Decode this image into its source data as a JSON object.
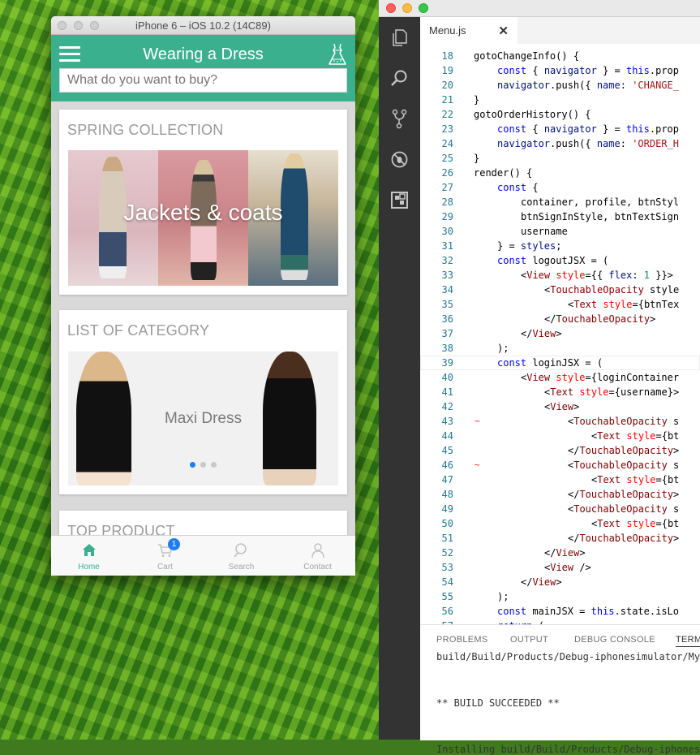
{
  "simulator": {
    "window_title": "iPhone 6 – iOS 10.2 (14C89)",
    "app": {
      "title": "Wearing a Dress",
      "search_placeholder": "What do you want to buy?",
      "sections": [
        {
          "title": "SPRING COLLECTION",
          "banner_caption": "Jackets & coats"
        },
        {
          "title": "LIST OF CATEGORY",
          "banner_caption": "Maxi Dress",
          "slide_count": 3,
          "active_slide": 1
        },
        {
          "title": "TOP PRODUCT"
        }
      ],
      "tabs": [
        {
          "label": "Home",
          "icon": "home-icon",
          "active": true
        },
        {
          "label": "Cart",
          "icon": "cart-icon",
          "badge": "1"
        },
        {
          "label": "Search",
          "icon": "search-icon"
        },
        {
          "label": "Contact",
          "icon": "person-icon"
        }
      ],
      "colors": {
        "brand": "#3ab08e",
        "active_tab": "#3ab08e",
        "badge": "#1e7ef0"
      }
    }
  },
  "editor": {
    "tab_label": "Menu.js",
    "close_glyph": "✕",
    "activity_icons": [
      "files-icon",
      "search-icon",
      "source-control-icon",
      "debug-icon",
      "extensions-icon"
    ],
    "lines": [
      {
        "n": "18",
        "indent": 1,
        "text": "gotoChangeInfo() {"
      },
      {
        "n": "19",
        "indent": 2,
        "text": "const { navigator } = this.prop"
      },
      {
        "n": "20",
        "indent": 2,
        "text": "navigator.push({ name: 'CHANGE_"
      },
      {
        "n": "21",
        "indent": 1,
        "text": "}"
      },
      {
        "n": "22",
        "indent": 1,
        "text": "gotoOrderHistory() {"
      },
      {
        "n": "23",
        "indent": 2,
        "text": "const { navigator } = this.prop"
      },
      {
        "n": "24",
        "indent": 2,
        "text": "navigator.push({ name: 'ORDER_H"
      },
      {
        "n": "25",
        "indent": 1,
        "text": "}"
      },
      {
        "n": "26",
        "indent": 1,
        "text": "render() {"
      },
      {
        "n": "27",
        "indent": 2,
        "text": "const {"
      },
      {
        "n": "28",
        "indent": 3,
        "text": "container, profile, btnStyl"
      },
      {
        "n": "29",
        "indent": 3,
        "text": "btnSignInStyle, btnTextSign"
      },
      {
        "n": "30",
        "indent": 3,
        "text": "username"
      },
      {
        "n": "31",
        "indent": 2,
        "text": "} = styles;"
      },
      {
        "n": "32",
        "indent": 2,
        "text": "const logoutJSX = ("
      },
      {
        "n": "33",
        "indent": 3,
        "text": "<View style={{ flex: 1 }}>"
      },
      {
        "n": "34",
        "indent": 4,
        "text": "<TouchableOpacity style"
      },
      {
        "n": "35",
        "indent": 5,
        "text": "<Text style={btnTex"
      },
      {
        "n": "36",
        "indent": 4,
        "text": "</TouchableOpacity>"
      },
      {
        "n": "37",
        "indent": 3,
        "text": "</View>"
      },
      {
        "n": "38",
        "indent": 2,
        "text": ");"
      },
      {
        "n": "39",
        "indent": 2,
        "text": "const loginJSX = ("
      },
      {
        "n": "40",
        "indent": 3,
        "text": "<View style={loginContainer"
      },
      {
        "n": "41",
        "indent": 4,
        "text": "<Text style={username}>"
      },
      {
        "n": "42",
        "indent": 4,
        "text": "<View>"
      },
      {
        "n": "43",
        "indent": 5,
        "text": "<TouchableOpacity s"
      },
      {
        "n": "44",
        "indent": 6,
        "text": "<Text style={bt"
      },
      {
        "n": "45",
        "indent": 5,
        "text": "</TouchableOpacity>"
      },
      {
        "n": "46",
        "indent": 5,
        "text": "<TouchableOpacity s"
      },
      {
        "n": "47",
        "indent": 6,
        "text": "<Text style={bt"
      },
      {
        "n": "48",
        "indent": 5,
        "text": "</TouchableOpacity>"
      },
      {
        "n": "49",
        "indent": 5,
        "text": "<TouchableOpacity s"
      },
      {
        "n": "50",
        "indent": 6,
        "text": "<Text style={bt"
      },
      {
        "n": "51",
        "indent": 5,
        "text": "</TouchableOpacity>"
      },
      {
        "n": "52",
        "indent": 4,
        "text": "</View>"
      },
      {
        "n": "53",
        "indent": 4,
        "text": "<View />"
      },
      {
        "n": "54",
        "indent": 3,
        "text": "</View>"
      },
      {
        "n": "55",
        "indent": 2,
        "text": ");"
      },
      {
        "n": "56",
        "indent": 2,
        "text": "const mainJSX = this.state.isLo"
      },
      {
        "n": "57",
        "indent": 2,
        "text": "return ("
      }
    ],
    "panel": {
      "tabs": [
        "PROBLEMS",
        "OUTPUT",
        "DEBUG CONSOLE",
        "TERM"
      ],
      "active_tab": "TERM",
      "terminal_lines": [
        "build/Build/Products/Debug-iphonesimulator/My",
        "",
        "",
        "** BUILD SUCCEEDED **",
        "",
        "",
        "Installing build/Build/Products/Debug-iphones"
      ]
    }
  }
}
